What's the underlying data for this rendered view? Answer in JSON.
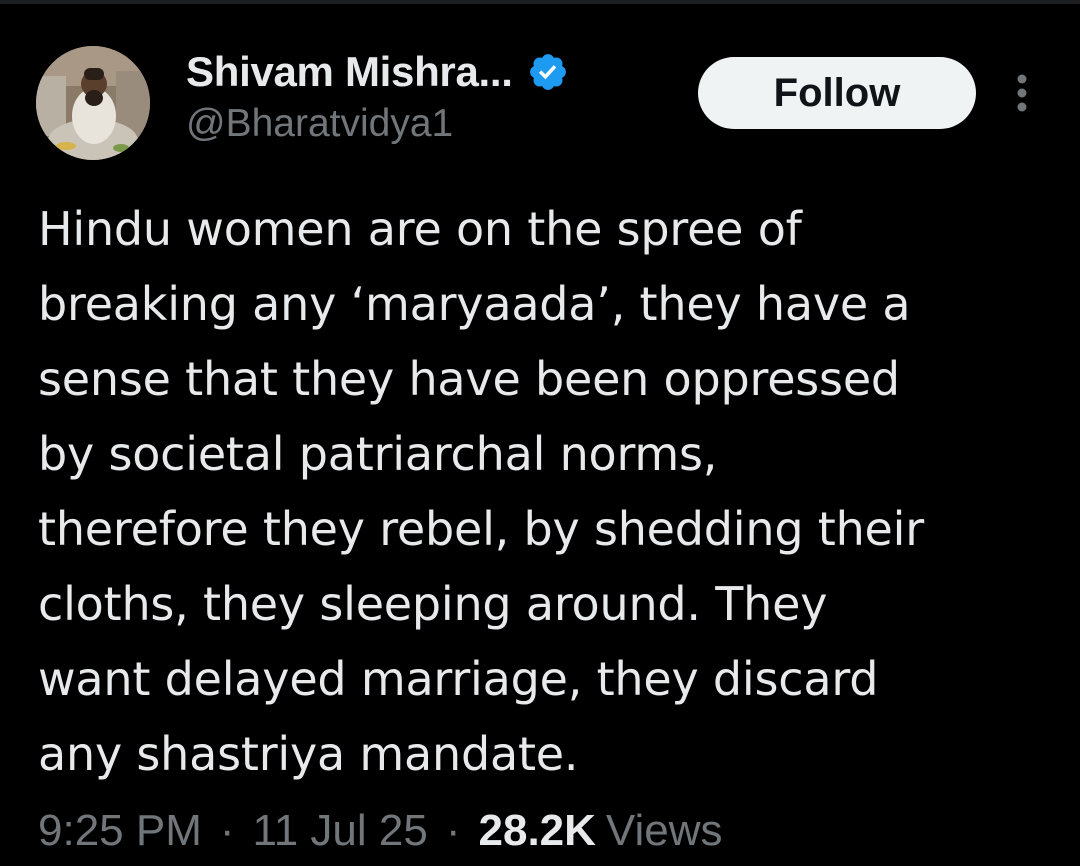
{
  "tweet": {
    "author": {
      "display_name": "Shivam Mishra...",
      "handle": "@Bharatvidya1",
      "verified": true
    },
    "follow_label": "Follow",
    "text": "Hindu women are on the spree of\nbreaking any ‘maryaada’, they have a\nsense that they have been oppressed\nby societal patriarchal norms,\ntherefore they rebel, by shedding their\ncloths, they sleeping around. They\nwant delayed marriage, they discard\nany shastriya mandate.",
    "meta": {
      "time": "9:25 PM",
      "separator": "·",
      "date": "11 Jul 25",
      "views_count": "28.2K",
      "views_label": "Views"
    }
  },
  "colors": {
    "background": "#000000",
    "text_primary": "#e7e9ea",
    "text_secondary": "#71767b",
    "verified_blue": "#1d9bf0",
    "follow_bg": "#eff3f4"
  },
  "icons": {
    "verified": "verified-badge-icon",
    "more": "more-vertical-icon"
  }
}
